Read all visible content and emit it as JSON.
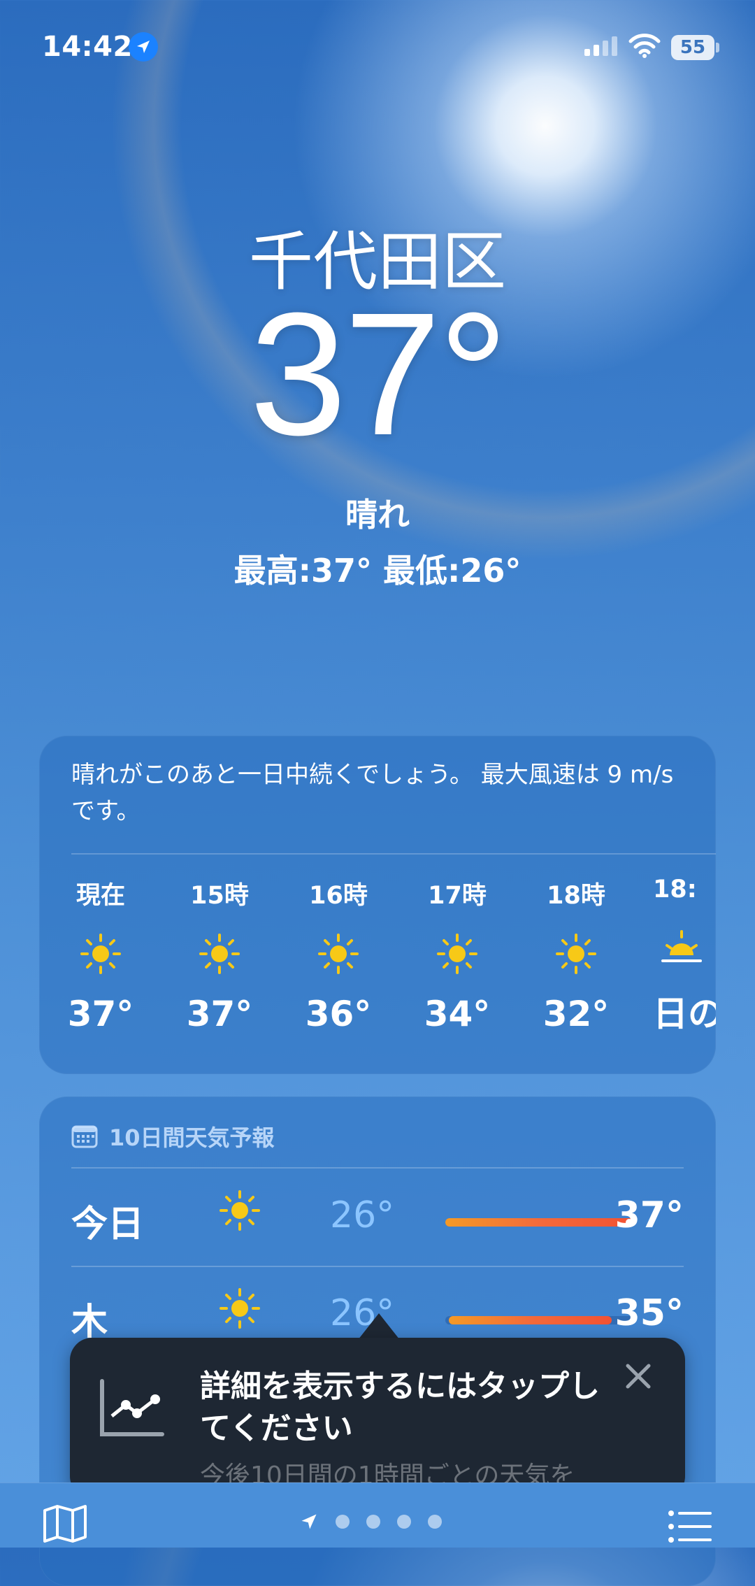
{
  "status_bar": {
    "time": "14:42",
    "battery": "55",
    "location_icon": "location-arrow-icon",
    "signal_icon": "cellular-signal-icon",
    "wifi_icon": "wifi-icon"
  },
  "current": {
    "city": "千代田区",
    "temperature": "37°",
    "condition": "晴れ",
    "high_low": "最高:37°  最低:26°"
  },
  "hourly": {
    "summary": "晴れがこのあと一日中続くでしょう。 最大風速は 9 m/sです。",
    "items": [
      {
        "label": "現在",
        "icon": "sun-icon",
        "temp": "37°"
      },
      {
        "label": "15時",
        "icon": "sun-icon",
        "temp": "37°"
      },
      {
        "label": "16時",
        "icon": "sun-icon",
        "temp": "36°"
      },
      {
        "label": "17時",
        "icon": "sun-icon",
        "temp": "34°"
      },
      {
        "label": "18時",
        "icon": "sun-icon",
        "temp": "32°"
      },
      {
        "label": "18:",
        "icon": "sunset-icon",
        "temp": "日の"
      }
    ]
  },
  "daily": {
    "header": "10日間天気予報",
    "header_icon": "calendar-icon",
    "rows": [
      {
        "day": "今日",
        "icon": "sun-icon",
        "low": "26°",
        "high": "37°",
        "bar_start": 0.0,
        "bar_end": 1.0,
        "current_marker": 1.0
      },
      {
        "day": "木",
        "icon": "sun-icon",
        "low": "26°",
        "high": "35°",
        "bar_start": 0.02,
        "bar_end": 0.88
      }
    ]
  },
  "tooltip": {
    "title": "詳細を表示するにはタップしてください",
    "subtitle": "今後10日間の1時間ごとの天気を",
    "icon": "chart-line-icon",
    "close_icon": "close-icon"
  },
  "bottom_bar": {
    "map_icon": "map-icon",
    "list_icon": "list-icon",
    "pages": 4
  },
  "colors": {
    "sun": "#f7c917",
    "bar_start": "#f59a26",
    "bar_end": "#f25233",
    "low_temp": "#8cc5ff",
    "tooltip_bg": "#1e2733"
  }
}
